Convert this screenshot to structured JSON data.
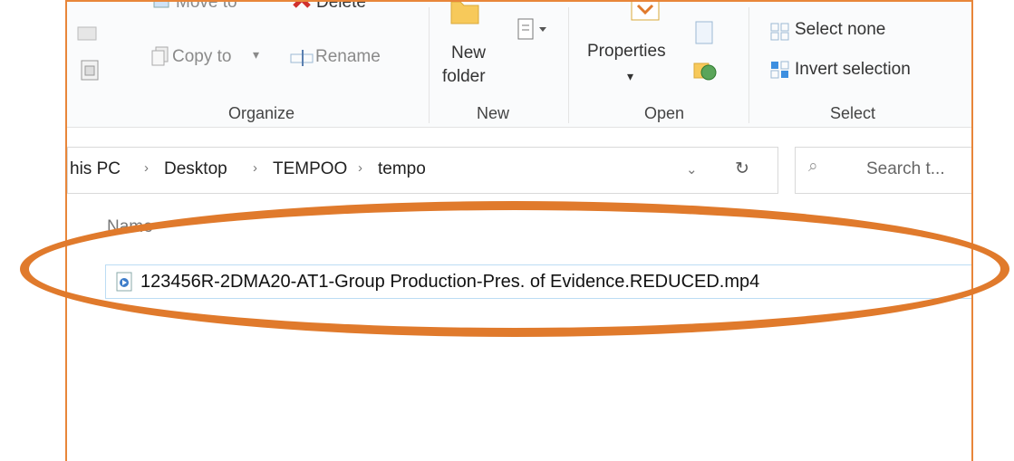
{
  "ribbon": {
    "move_to": "Move to",
    "delete": "Delete",
    "copy_to": "Copy to",
    "rename": "Rename",
    "new_folder_line1": "New",
    "new_folder_line2": "folder",
    "properties": "Properties",
    "select_none": "Select none",
    "invert_selection": "Invert selection",
    "groups": {
      "organize": "Organize",
      "new": "New",
      "open": "Open",
      "select": "Select"
    }
  },
  "address": {
    "crumbs": [
      "his PC",
      "Desktop",
      "TEMPOO",
      "tempo"
    ]
  },
  "search": {
    "placeholder": "Search t..."
  },
  "list": {
    "column_name": "Name",
    "files": [
      {
        "name": "123456R-2DMA20-AT1-Group Production-Pres. of Evidence.REDUCED.mp4",
        "icon": "video-file-icon"
      }
    ]
  },
  "colors": {
    "frame_border": "#e8863a",
    "annotation_ellipse": "#e07a2c",
    "selection_border": "#bcdcf4"
  }
}
